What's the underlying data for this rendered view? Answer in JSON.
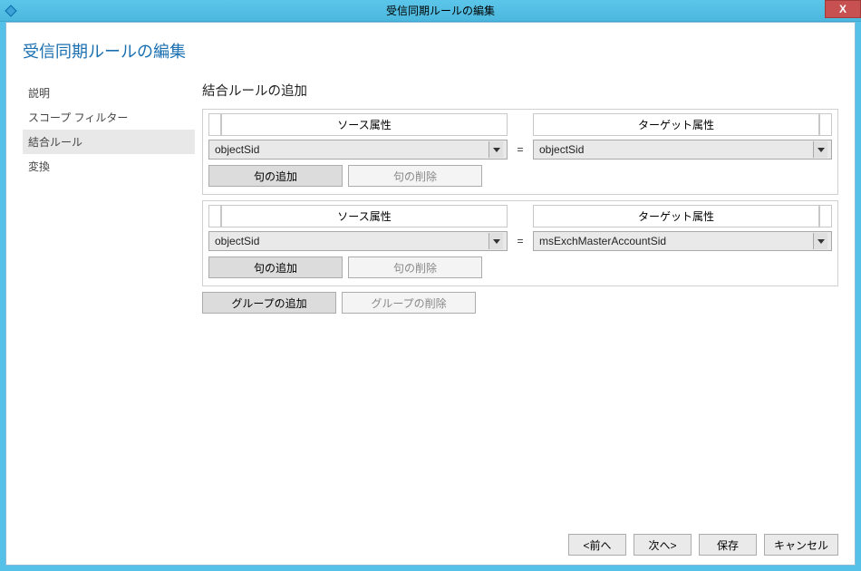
{
  "window": {
    "title": "受信同期ルールの編集",
    "close_label": "X"
  },
  "page": {
    "title": "受信同期ルールの編集"
  },
  "sidebar": {
    "items": [
      {
        "label": "説明",
        "selected": false
      },
      {
        "label": "スコープ フィルター",
        "selected": false
      },
      {
        "label": "結合ルール",
        "selected": true
      },
      {
        "label": "変換",
        "selected": false
      }
    ]
  },
  "section": {
    "title": "結合ルールの追加"
  },
  "headers": {
    "source": "ソース属性",
    "target": "ターゲット属性"
  },
  "groups": [
    {
      "source_value": "objectSid",
      "target_value": "objectSid",
      "add_clause_label": "句の追加",
      "remove_clause_label": "句の削除"
    },
    {
      "source_value": "objectSid",
      "target_value": "msExchMasterAccountSid",
      "add_clause_label": "句の追加",
      "remove_clause_label": "句の削除"
    }
  ],
  "group_buttons": {
    "add": "グループの追加",
    "remove": "グループの削除"
  },
  "footer": {
    "back": "<前へ",
    "next": "次へ>",
    "save": "保存",
    "cancel": "キャンセル"
  },
  "eq_symbol": "="
}
